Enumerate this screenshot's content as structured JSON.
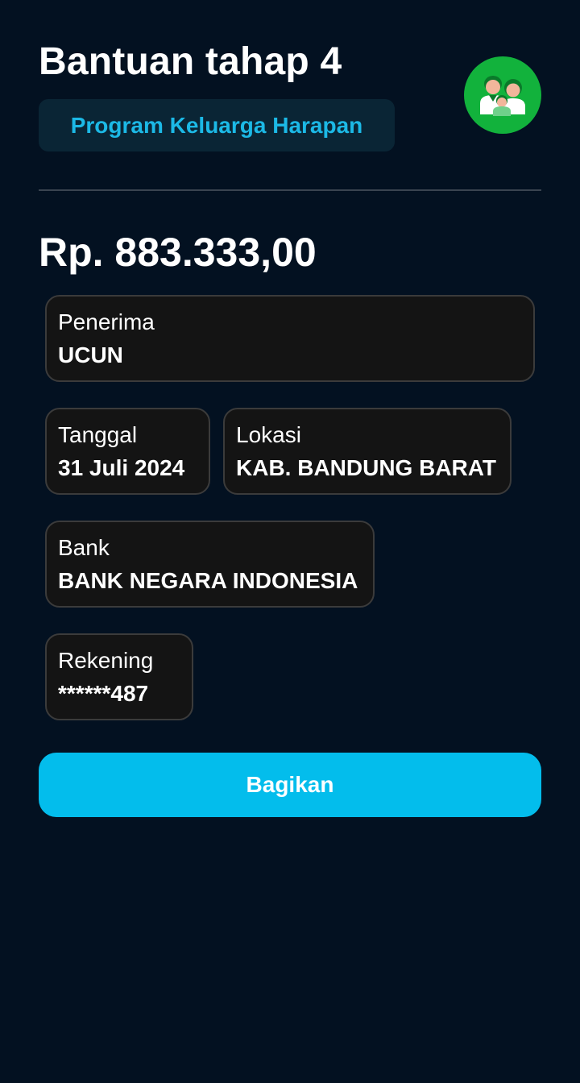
{
  "header": {
    "title": "Bantuan tahap 4",
    "program": "Program Keluarga Harapan",
    "avatar_icon": "family-icon",
    "avatar_color": "#12b23c"
  },
  "amount": "Rp. 883.333,00",
  "details": {
    "recipient": {
      "label": "Penerima",
      "value": "UCUN"
    },
    "date": {
      "label": "Tanggal",
      "value": "31 Juli 2024"
    },
    "location": {
      "label": "Lokasi",
      "value": "KAB. BANDUNG BARAT"
    },
    "bank": {
      "label": "Bank",
      "value": "BANK NEGARA INDONESIA"
    },
    "account": {
      "label": "Rekening",
      "value": "******487"
    }
  },
  "actions": {
    "share_label": "Bagikan"
  },
  "colors": {
    "background": "#031121",
    "accent": "#03bdec",
    "badge_text": "#1cb9e6",
    "card_background": "#141414"
  }
}
